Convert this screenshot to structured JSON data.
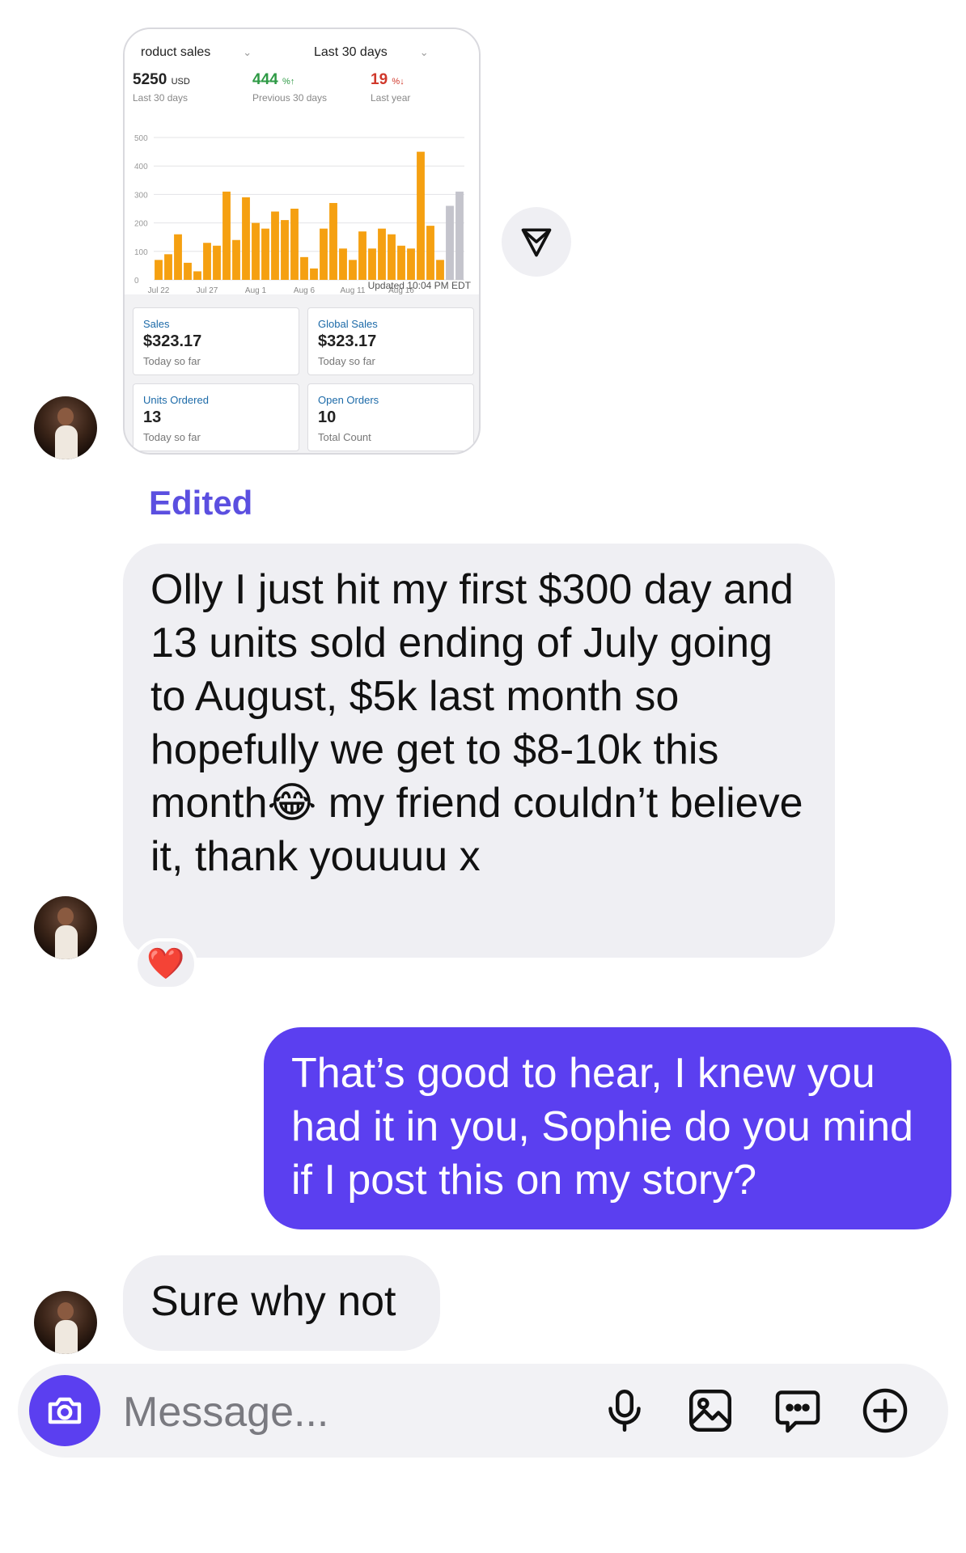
{
  "shared_screenshot": {
    "product_select": "roduct sales",
    "period_select": "Last 30 days",
    "kpis": [
      {
        "value": "5250",
        "unit": "USD",
        "label": "Last 30 days"
      },
      {
        "value": "444",
        "unit": "%↑",
        "label": "Previous 30 days",
        "color": "#2e9a45"
      },
      {
        "value": "19",
        "unit": "%↓",
        "label": "Last year",
        "color": "#d0382b"
      }
    ],
    "updated": "Updated 10:04 PM EDT",
    "tiles": [
      {
        "label": "Sales",
        "value": "$323.17",
        "sub": "Today so far"
      },
      {
        "label": "Global Sales",
        "value": "$323.17",
        "sub": "Today so far"
      },
      {
        "label": "Units Ordered",
        "value": "13",
        "sub": "Today so far"
      },
      {
        "label": "Open Orders",
        "value": "10",
        "sub": "Total Count"
      }
    ]
  },
  "chart_data": {
    "type": "bar",
    "x_ticks": [
      "Jul 22",
      "Jul 27",
      "Aug 1",
      "Aug 6",
      "Aug 11",
      "Aug 16"
    ],
    "y_ticks": [
      "0",
      "100",
      "200",
      "300",
      "400",
      "500"
    ],
    "ylim": [
      0,
      500
    ],
    "values": [
      70,
      90,
      160,
      60,
      30,
      130,
      120,
      310,
      140,
      290,
      200,
      180,
      240,
      210,
      250,
      80,
      40,
      180,
      270,
      110,
      70,
      170,
      110,
      180,
      160,
      120,
      110,
      450,
      190,
      70,
      260,
      310
    ],
    "bar_colors": {
      "normal": "#f5a011",
      "highlight_last": "#c4c4cc"
    },
    "highlighted_indices": [
      30,
      31
    ],
    "grid": true
  },
  "messages": {
    "edited_label": "Edited",
    "msg1": "Olly I just hit my first $300 day and 13 units sold ending of July going to August, $5k last month so hopefully we get to $8-10k this month😂  my friend couldn’t believe it, thank youuuu x",
    "msg1_reaction": "❤️",
    "msg2": "That’s good to hear, I knew you had it in you, Sophie do you mind if I post this on my story?",
    "msg3": "Sure why not"
  },
  "composer": {
    "placeholder": "Message...",
    "icons": [
      "camera-icon",
      "microphone-icon",
      "image-icon",
      "sticker-chat-icon",
      "plus-circle-icon"
    ]
  },
  "colors": {
    "accent": "#5b3ff0",
    "edited": "#5b4fe0",
    "incoming_bubble": "#efeff3"
  }
}
